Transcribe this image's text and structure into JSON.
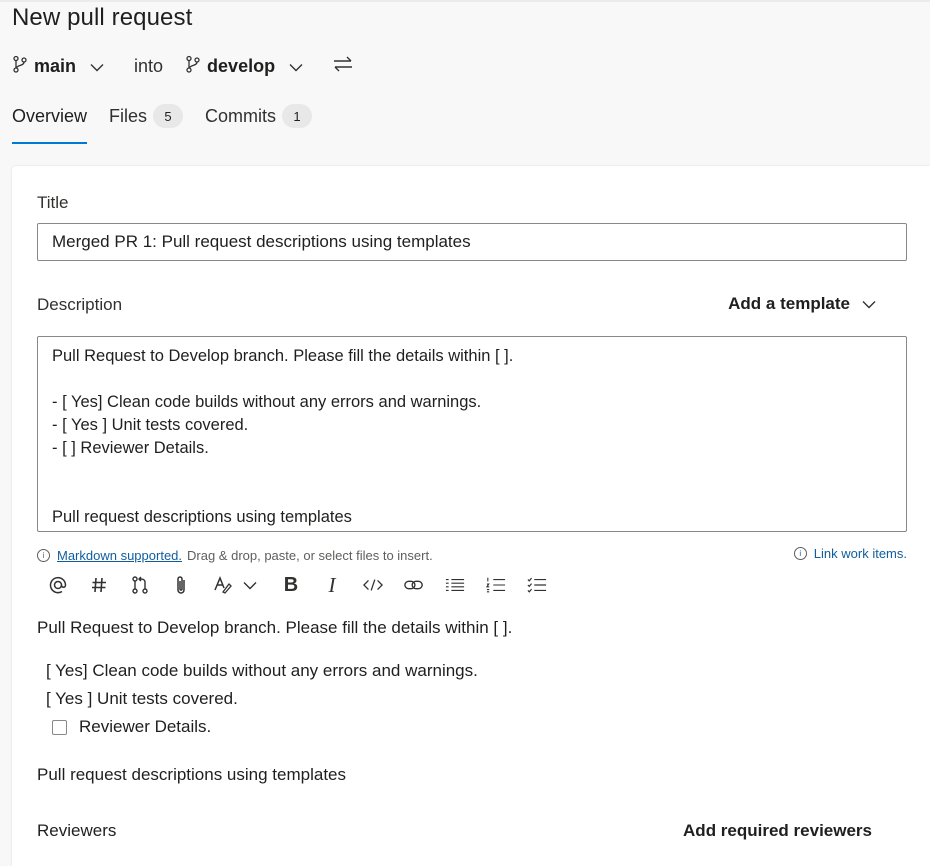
{
  "header": {
    "title": "New pull request",
    "source_branch": "main",
    "into_label": "into",
    "target_branch": "develop"
  },
  "tabs": [
    {
      "label": "Overview",
      "count": ""
    },
    {
      "label": "Files",
      "count": "5"
    },
    {
      "label": "Commits",
      "count": "1"
    }
  ],
  "form": {
    "title_label": "Title",
    "title_value": "Merged PR 1: Pull request descriptions using templates",
    "description_label": "Description",
    "add_template_label": "Add a template",
    "description_value": "Pull Request to Develop branch. Please fill the details within [ ].\n\n- [ Yes] Clean code builds without any errors and warnings.\n- [ Yes ] Unit tests covered.\n- [ ] Reviewer Details.\n\n\nPull request descriptions using templates",
    "markdown_link": "Markdown supported.",
    "hint_text": "Drag & drop, paste, or select files to insert.",
    "link_work_items": "Link work items."
  },
  "preview": {
    "line1": "Pull Request to Develop branch. Please fill the details within [ ].",
    "item1": "[ Yes] Clean code builds without any errors and warnings.",
    "item2": "[ Yes ] Unit tests covered.",
    "item3": "Reviewer Details.",
    "footer": "Pull request descriptions using templates"
  },
  "reviewers": {
    "label": "Reviewers",
    "add_required": "Add required reviewers"
  },
  "colors": {
    "accent": "#0078d4",
    "link": "#0f5d9e"
  },
  "icons": [
    "branch-icon",
    "chevron-down-icon",
    "swap-icon",
    "info-icon",
    "mention-icon",
    "hash-icon",
    "pull-request-icon",
    "attachment-icon",
    "highlight-icon",
    "bold-icon",
    "italic-icon",
    "code-icon",
    "link-icon",
    "bulleted-list-icon",
    "numbered-list-icon",
    "checklist-icon"
  ]
}
